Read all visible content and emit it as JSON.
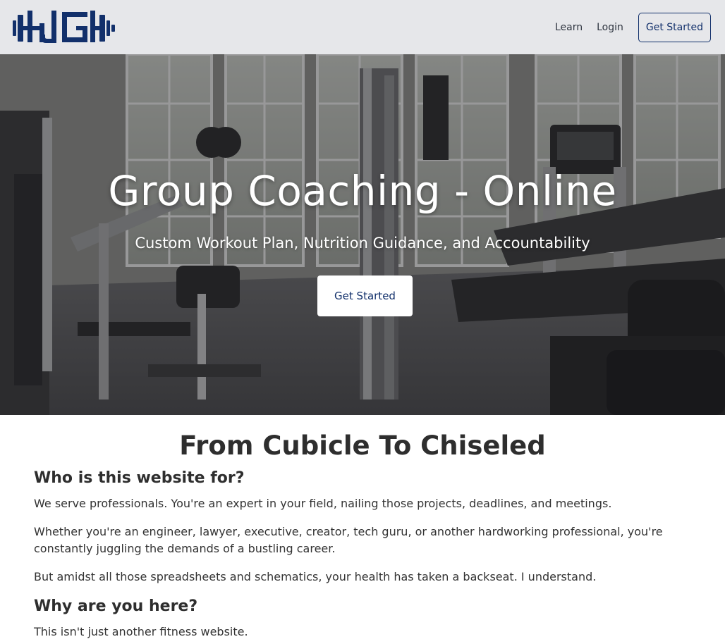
{
  "nav": {
    "logo_alt": "HJG",
    "learn": "Learn",
    "login": "Login",
    "get_started": "Get Started"
  },
  "hero": {
    "title": "Group Coaching - Online",
    "subtitle": "Custom Workout Plan, Nutrition Guidance, and Accountability",
    "cta": "Get Started"
  },
  "content": {
    "section_title": "From Cubicle To Chiseled",
    "heading_who": "Who is this website for?",
    "para_1": "We serve professionals. You're an expert in your field, nailing those projects, deadlines, and meetings.",
    "para_2": "Whether you're an engineer, lawyer, executive, creator, tech guru, or another hardworking professional, you're constantly juggling the demands of a bustling career.",
    "para_3": "But amidst all those spreadsheets and schematics, your health has taken a backseat. I understand.",
    "heading_why": "Why are you here?",
    "para_4": "This isn't just another fitness website."
  },
  "colors": {
    "brand_navy": "#12306b",
    "navbar_bg": "#e6e7ea",
    "text_dark": "#2e2e2e"
  }
}
